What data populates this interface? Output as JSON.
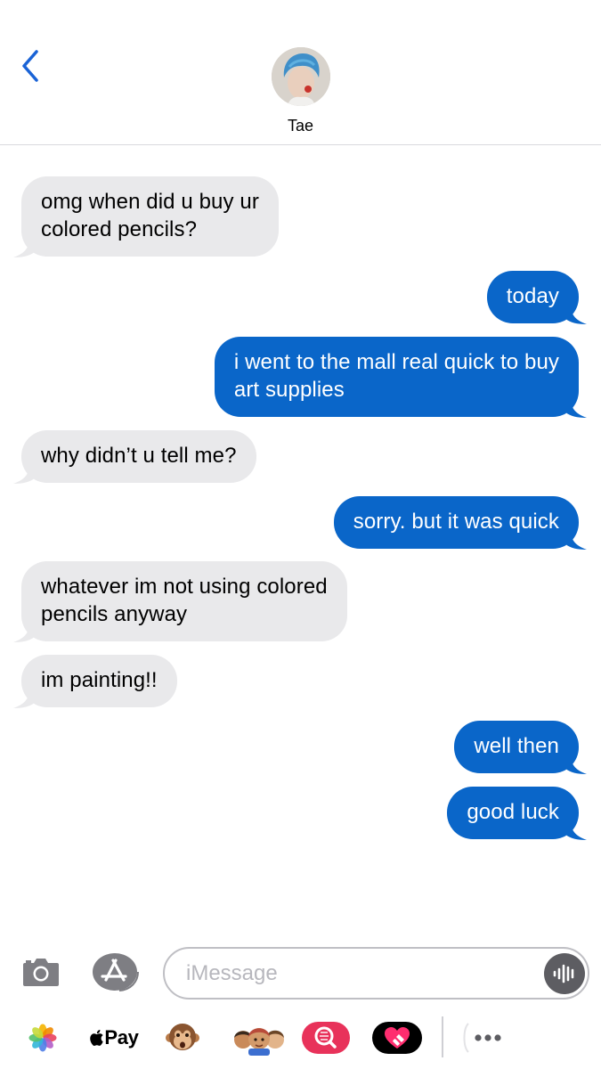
{
  "header": {
    "contact_name": "Tae"
  },
  "colors": {
    "incoming_bubble": "#e9e9eb",
    "outgoing_bubble": "#0a66c9",
    "accent": "#1a63d6"
  },
  "messages": [
    {
      "direction": "incoming",
      "lines": [
        "omg when did u buy ur",
        "colored pencils?"
      ]
    },
    {
      "direction": "outgoing",
      "lines": [
        "today"
      ]
    },
    {
      "direction": "outgoing",
      "lines": [
        "i went to the mall real quick to buy",
        "art supplies"
      ]
    },
    {
      "direction": "incoming",
      "lines": [
        "why didn’t u tell me?"
      ]
    },
    {
      "direction": "outgoing",
      "lines": [
        "sorry. but it was quick"
      ]
    },
    {
      "direction": "incoming",
      "lines": [
        "whatever im not using colored",
        "pencils anyway"
      ]
    },
    {
      "direction": "incoming",
      "lines": [
        "im painting!!"
      ]
    },
    {
      "direction": "outgoing",
      "lines": [
        "well then"
      ]
    },
    {
      "direction": "outgoing",
      "lines": [
        "good luck"
      ]
    }
  ],
  "input": {
    "placeholder": "iMessage"
  },
  "tray": {
    "apple_pay_label": "Pay",
    "icons": [
      "photos-icon",
      "apple-pay-icon",
      "monkey-animoji-icon",
      "memoji-icon",
      "image-search-icon",
      "digital-touch-icon",
      "more-icon"
    ]
  }
}
